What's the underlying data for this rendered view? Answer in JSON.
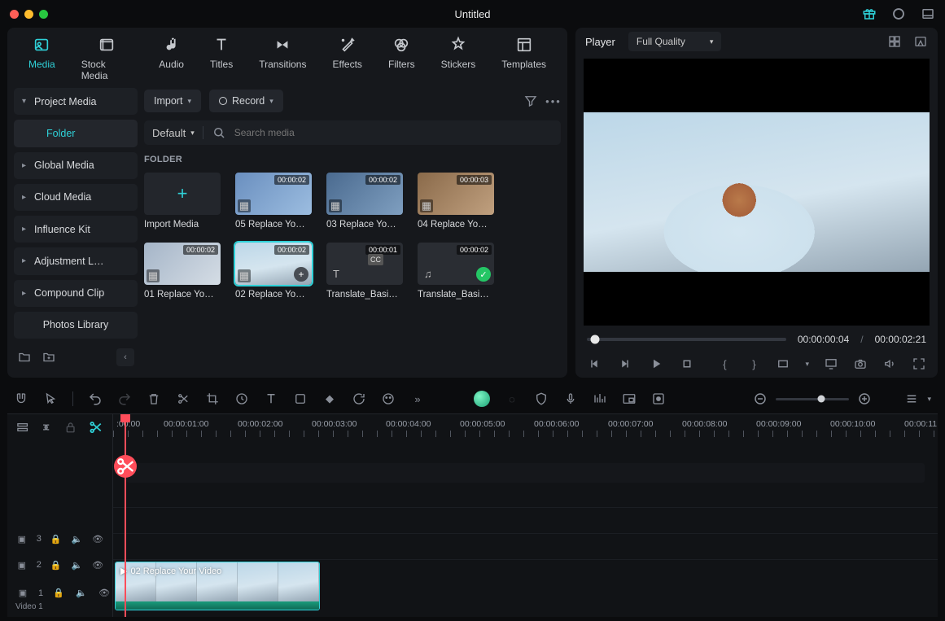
{
  "window": {
    "title": "Untitled"
  },
  "tabs": {
    "media": "Media",
    "stock": "Stock Media",
    "audio": "Audio",
    "titles": "Titles",
    "transitions": "Transitions",
    "effects": "Effects",
    "filters": "Filters",
    "stickers": "Stickers",
    "templates": "Templates"
  },
  "sidebar": {
    "project": "Project Media",
    "folder": "Folder",
    "global": "Global Media",
    "cloud": "Cloud Media",
    "influence": "Influence Kit",
    "adjustment": "Adjustment L…",
    "compound": "Compound Clip",
    "photos": "Photos Library"
  },
  "toolbar": {
    "import": "Import",
    "record": "Record",
    "sort": "Default",
    "search_placeholder": "Search media"
  },
  "folder_header": "FOLDER",
  "clips": {
    "import": "Import Media",
    "c05": {
      "dur": "00:00:02",
      "label": "05 Replace Yo…"
    },
    "c03": {
      "dur": "00:00:02",
      "label": "03 Replace Yo…"
    },
    "c04": {
      "dur": "00:00:03",
      "label": "04 Replace Yo…"
    },
    "c01": {
      "dur": "00:00:02",
      "label": "01 Replace Yo…"
    },
    "c02": {
      "dur": "00:00:02",
      "label": "02 Replace Yo…"
    },
    "t1": {
      "dur": "00:00:01",
      "label": "Translate_Basi…"
    },
    "t2": {
      "dur": "00:00:02",
      "label": "Translate_Basi…"
    }
  },
  "player": {
    "label": "Player",
    "quality": "Full Quality",
    "current": "00:00:00:04",
    "sep": "/",
    "total": "00:00:02:21"
  },
  "ruler": {
    "t0": ":00:00",
    "t1": "00:00:01:00",
    "t2": "00:00:02:00",
    "t3": "00:00:03:00",
    "t4": "00:00:04:00",
    "t5": "00:00:05:00",
    "t6": "00:00:06:00",
    "t7": "00:00:07:00",
    "t8": "00:00:08:00",
    "t9": "00:00:09:00",
    "t10": "00:00:10:00",
    "t11": "00:00:11:"
  },
  "tracks": {
    "v3": "3",
    "v2": "2",
    "v1": "1",
    "v1label": "Video 1",
    "clip_label": "02 Replace Your Video"
  }
}
